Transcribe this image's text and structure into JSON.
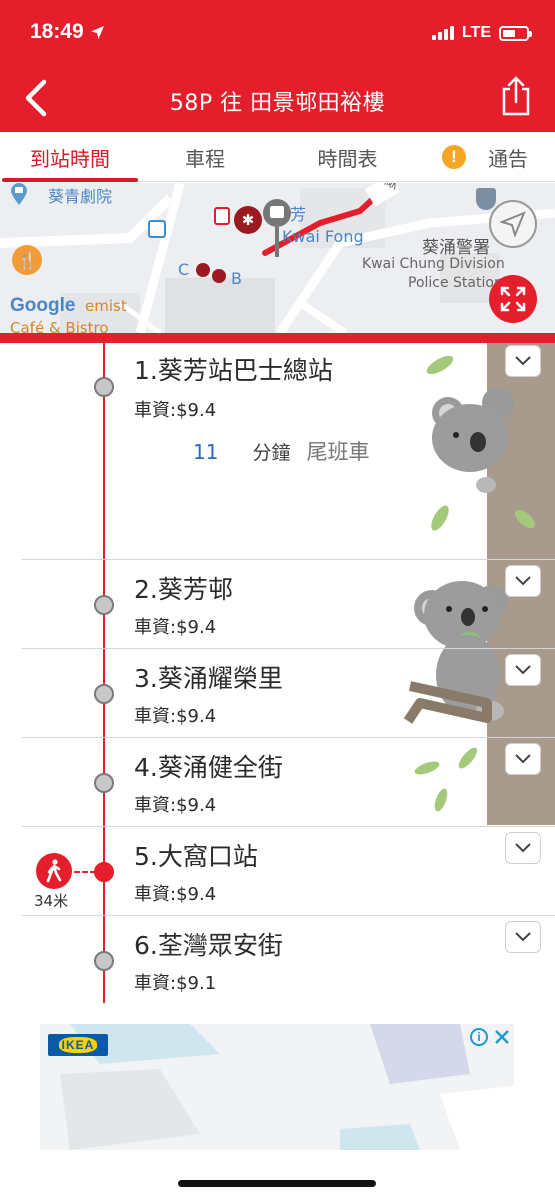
{
  "status_bar": {
    "time": "18:49",
    "network": "LTE"
  },
  "nav": {
    "title": "58P 往 田景邨田裕樓",
    "back_icon": "chevron-left-icon",
    "share_icon": "share-icon"
  },
  "tabs": [
    {
      "label": "到站時間",
      "active": true
    },
    {
      "label": "車程",
      "active": false
    },
    {
      "label": "時間表",
      "active": false
    },
    {
      "label": "通告",
      "active": false,
      "icon": "alert-icon"
    }
  ],
  "map": {
    "labels": {
      "theatre": "葵青劇院",
      "kwai_fong_zh": "芳",
      "kwai_fong_en": "Kwai Fong",
      "police_zh": "葵涌警署",
      "police_en_1": "Kwai Chung Division",
      "police_en_2": "Police Station",
      "exit_c": "C",
      "exit_b": "B",
      "google": "Google",
      "cafe_1": "emist",
      "cafe_2": "Café & Bistro",
      "street": "葵義"
    },
    "accent_color": "#e41e2b"
  },
  "stops": [
    {
      "name": "1.葵芳站巴士總站",
      "fare": "車資:$9.4",
      "eta": {
        "minutes": "11",
        "unit": "分鐘",
        "note": "尾班車"
      }
    },
    {
      "name": "2.葵芳邨",
      "fare": "車資:$9.4"
    },
    {
      "name": "3.葵涌耀榮里",
      "fare": "車資:$9.4"
    },
    {
      "name": "4.葵涌健全街",
      "fare": "車資:$9.4"
    },
    {
      "name": "5.大窩口站",
      "fare": "車資:$9.4",
      "nearest": true,
      "walk_distance": "34米"
    },
    {
      "name": "6.荃灣眾安街",
      "fare": "車資:$9.1"
    }
  ],
  "ad": {
    "brand": "IKEA"
  },
  "colors": {
    "brand_red": "#e41e2b",
    "eta_blue": "#2a6bb5"
  }
}
